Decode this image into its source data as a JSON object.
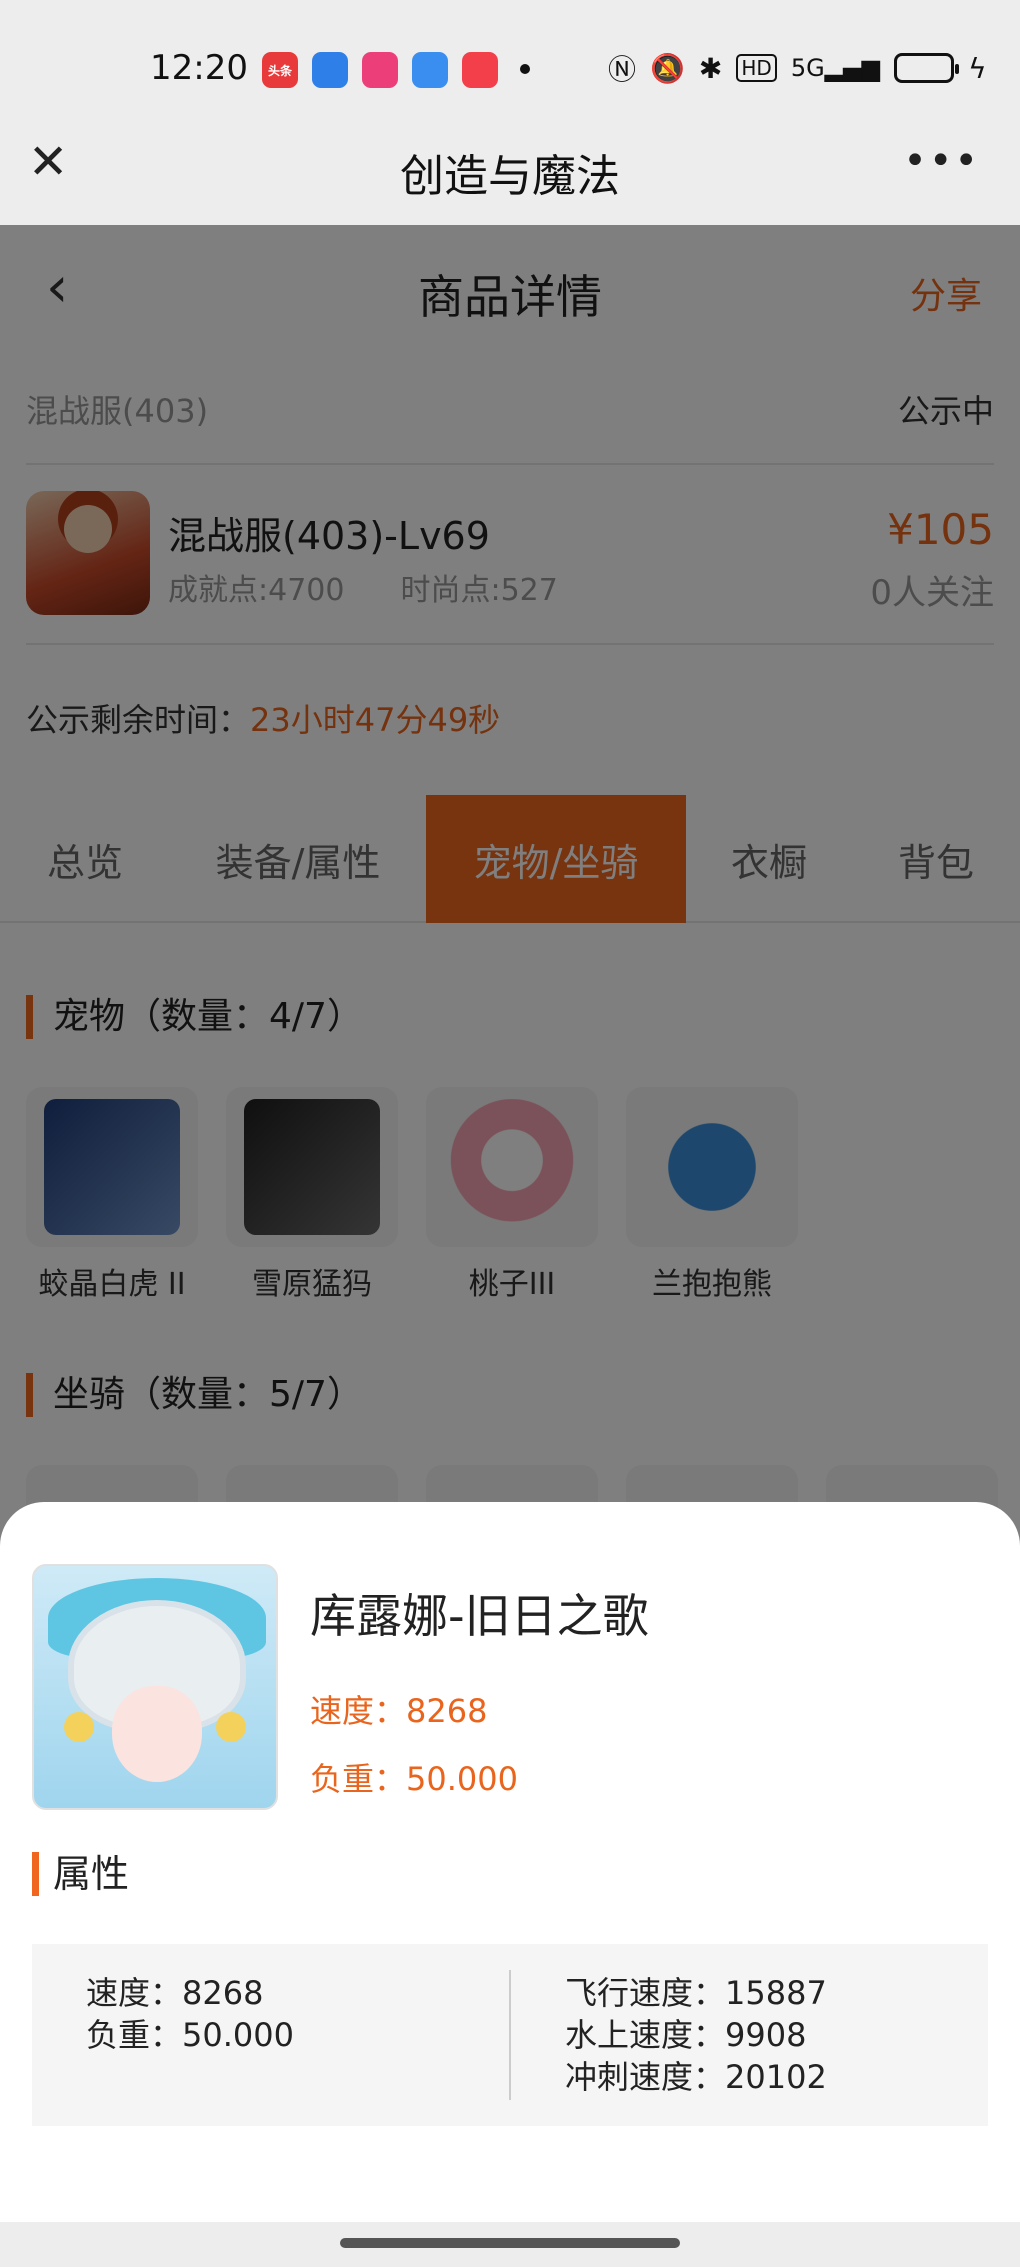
{
  "status_bar": {
    "time": "12:20",
    "apps": [
      {
        "icon": "toutiao-icon",
        "text": "头条",
        "color": "#e83a3a"
      },
      {
        "icon": "blue-app-icon",
        "text": "",
        "color": "#2f7fe8"
      },
      {
        "icon": "pink-app-icon",
        "text": "",
        "color": "#ec3f79"
      },
      {
        "icon": "search-app-icon",
        "text": "",
        "color": "#3a8ef0"
      },
      {
        "icon": "music-app-icon",
        "text": "",
        "color": "#f23f4a"
      }
    ],
    "system_icons": [
      "nfc-icon",
      "mute-icon",
      "bluetooth-icon",
      "hd-icon",
      "5g-signal-icon",
      "battery-icon",
      "charging-icon"
    ]
  },
  "wechat_nav": {
    "title": "创造与魔法",
    "close_icon": "✕",
    "more_icon": "•••"
  },
  "page": {
    "back_icon": "‹",
    "title": "商品详情",
    "share_label": "分享",
    "server": "混战服(403)",
    "status": "公示中",
    "character": {
      "name": "混战服(403)-Lv69",
      "achievement": "成就点:4700",
      "fashion": "时尚点:527",
      "price": "¥105",
      "watchers": "0人关注"
    },
    "remain_label": "公示剩余时间：",
    "remain_value": "23小时47分49秒",
    "tabs": [
      {
        "label": "总览",
        "active": false
      },
      {
        "label": "装备/属性",
        "active": false
      },
      {
        "label": "宠物/坐骑",
        "active": true
      },
      {
        "label": "衣橱",
        "active": false
      },
      {
        "label": "背包",
        "active": false
      }
    ],
    "pets_title": "宠物",
    "pets_count": "（数量：4/7）",
    "pets": [
      {
        "name": "蛟晶白虎 II",
        "color": "#2b5a9e"
      },
      {
        "name": "雪原猛犸",
        "color": "#3c3c3c"
      },
      {
        "name": "桃子III",
        "color": "#f58fa8"
      },
      {
        "name": "兰抱抱熊",
        "color": "#3b8fd8"
      }
    ],
    "mounts_title": "坐骑",
    "mounts_count": "（数量：5/7）"
  },
  "sheet": {
    "name": "库露娜-旧日之歌",
    "speed_line": "速度：8268",
    "load_line": "负重：50.000",
    "attr_title": "属性",
    "attrs_left": [
      "速度：8268",
      "负重：50.000"
    ],
    "attrs_right": [
      "飞行速度：15887",
      "水上速度：9908",
      "冲刺速度：20102"
    ]
  }
}
